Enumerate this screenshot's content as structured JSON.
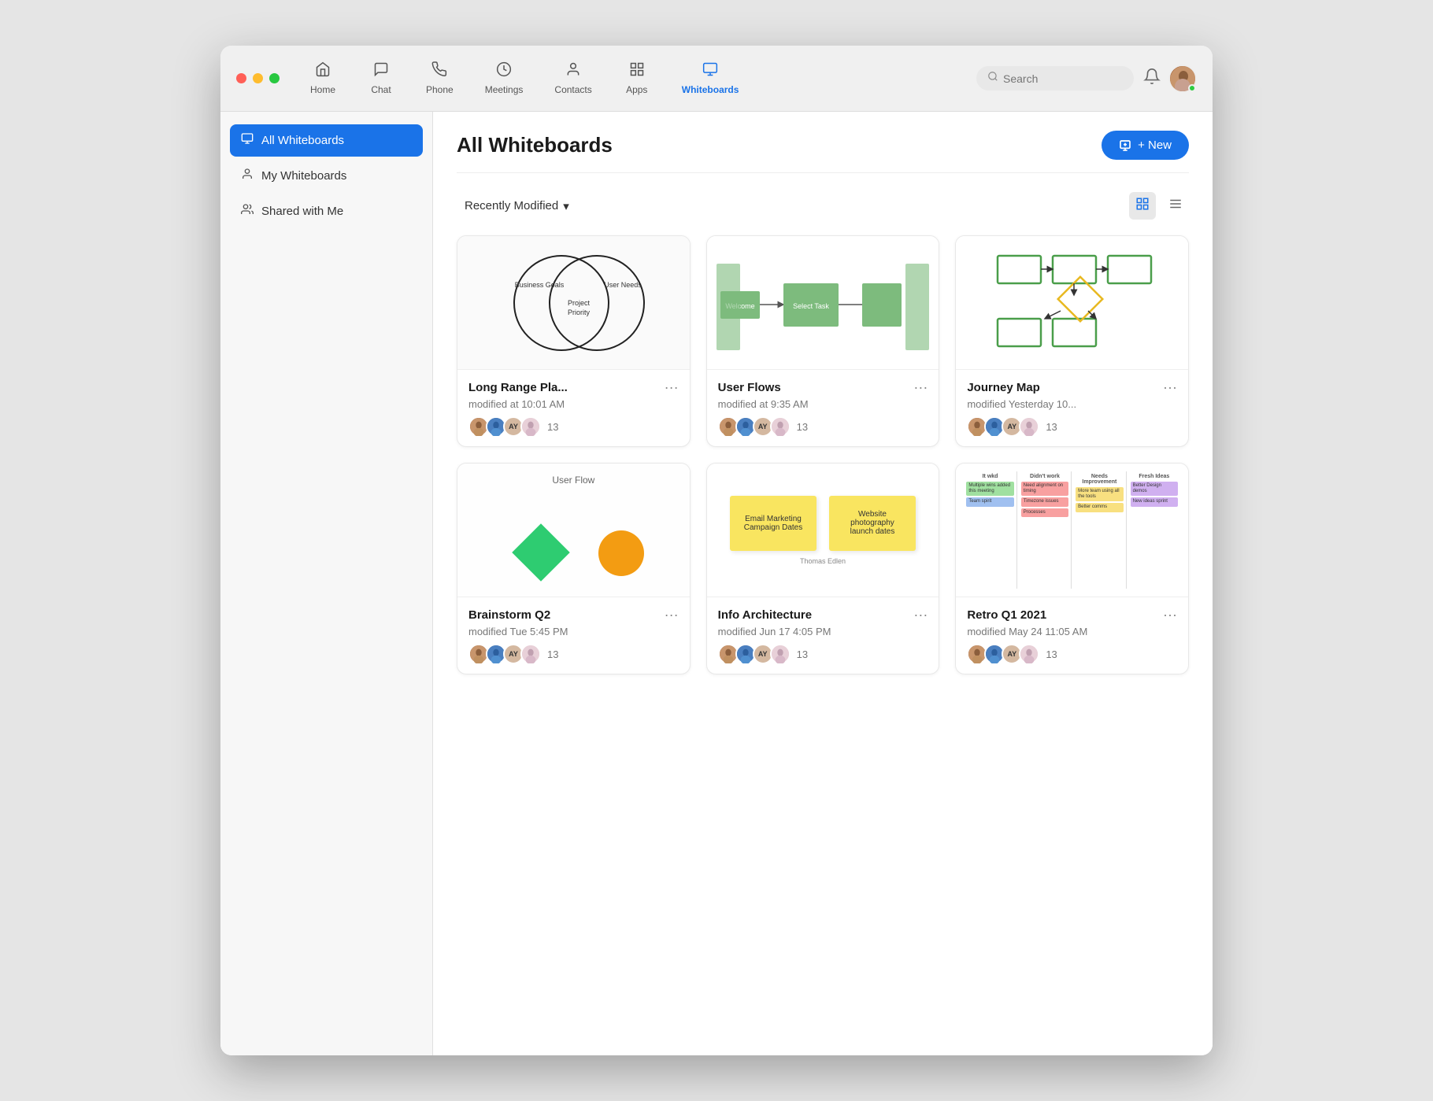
{
  "window": {
    "title": "Whiteboards"
  },
  "nav": {
    "items": [
      {
        "id": "home",
        "label": "Home",
        "icon": "🏠",
        "active": false
      },
      {
        "id": "chat",
        "label": "Chat",
        "icon": "💬",
        "active": false
      },
      {
        "id": "phone",
        "label": "Phone",
        "icon": "📞",
        "active": false
      },
      {
        "id": "meetings",
        "label": "Meetings",
        "icon": "🕐",
        "active": false
      },
      {
        "id": "contacts",
        "label": "Contacts",
        "icon": "👤",
        "active": false
      },
      {
        "id": "apps",
        "label": "Apps",
        "icon": "⊞",
        "active": false
      },
      {
        "id": "whiteboards",
        "label": "Whiteboards",
        "icon": "🖥",
        "active": true
      }
    ],
    "search_placeholder": "Search",
    "new_button_label": "New"
  },
  "sidebar": {
    "items": [
      {
        "id": "all-whiteboards",
        "label": "All Whiteboards",
        "icon": "🖥",
        "active": true
      },
      {
        "id": "my-whiteboards",
        "label": "My Whiteboards",
        "icon": "👤",
        "active": false
      },
      {
        "id": "shared-with-me",
        "label": "Shared with Me",
        "icon": "👥",
        "active": false
      }
    ]
  },
  "content": {
    "page_title": "All Whiteboards",
    "new_button_label": "+ New",
    "filter": {
      "label": "Recently Modified",
      "chevron": "▾"
    },
    "view_toggle": {
      "grid_label": "⊞",
      "list_label": "≡"
    },
    "whiteboards": [
      {
        "id": "wb1",
        "title": "Long Range Pla...",
        "modified": "modified at 10:01 AM",
        "collaborators_count": "13",
        "type": "venn"
      },
      {
        "id": "wb2",
        "title": "User Flows",
        "modified": "modified at 9:35 AM",
        "collaborators_count": "13",
        "type": "flow"
      },
      {
        "id": "wb3",
        "title": "Journey Map",
        "modified": "modified Yesterday 10...",
        "collaborators_count": "13",
        "type": "journey"
      },
      {
        "id": "wb4",
        "title": "Brainstorm Q2",
        "modified": "modified Tue 5:45 PM",
        "collaborators_count": "13",
        "type": "brainstorm"
      },
      {
        "id": "wb5",
        "title": "Info Architecture",
        "modified": "modified Jun 17 4:05 PM",
        "collaborators_count": "13",
        "type": "info"
      },
      {
        "id": "wb6",
        "title": "Retro Q1 2021",
        "modified": "modified May 24 11:05 AM",
        "collaborators_count": "13",
        "type": "retro"
      }
    ],
    "venn": {
      "label_left": "Business Goals",
      "label_right": "User Needs",
      "label_center": "Project Priority"
    },
    "flow": {
      "step1": "Welcome",
      "step2": "Select Task"
    },
    "info": {
      "note1": "Email Marketing Campaign Dates",
      "note2": "Website photography launch dates",
      "author": "Thomas Edlen"
    },
    "retro": {
      "cols": [
        "It wkd",
        "Didn't work",
        "Needs Improvement",
        "Fresh Ideas"
      ]
    }
  },
  "avatars": {
    "colors": [
      "#8B4513",
      "#2c5f9e",
      "#c0a080",
      "#d0b0c0"
    ]
  }
}
